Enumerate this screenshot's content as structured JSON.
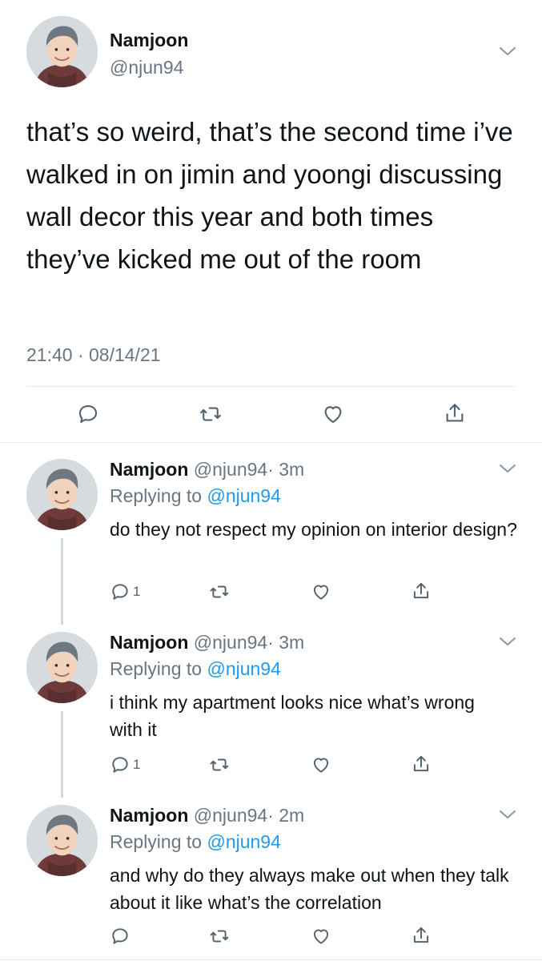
{
  "main_tweet": {
    "display_name": "Namjoon",
    "handle": "@njun94",
    "text": "that’s so weird, that’s the second time i’ve walked in on jimin and yoongi discussing wall decor this year and both times they’ve kicked me out of the room",
    "timestamp": "21:40 · 08/14/21"
  },
  "replies": [
    {
      "display_name": "Namjoon",
      "handle": "@njun94",
      "time": "· 3m",
      "replying_label": "Replying to",
      "replying_to": "@njun94",
      "text": "do they not respect my opinion on interior design?",
      "reply_count": "1"
    },
    {
      "display_name": "Namjoon",
      "handle": "@njun94",
      "time": "· 3m",
      "replying_label": "Replying to",
      "replying_to": "@njun94",
      "text": "i think my apartment looks nice what’s wrong with it",
      "reply_count": "1"
    },
    {
      "display_name": "Namjoon",
      "handle": "@njun94",
      "time": "· 2m",
      "replying_label": "Replying to",
      "replying_to": "@njun94",
      "text": "and why do they always make out when they talk about it like what’s the correlation",
      "reply_count": ""
    }
  ],
  "icons": {
    "reply": "reply-icon",
    "retweet": "retweet-icon",
    "like": "heart-icon",
    "share": "share-icon",
    "more": "chevron-down-icon"
  },
  "colors": {
    "link": "#1d9bf0",
    "secondary_text": "#687684",
    "icon": "#536471",
    "divider": "#e6ecf0"
  }
}
